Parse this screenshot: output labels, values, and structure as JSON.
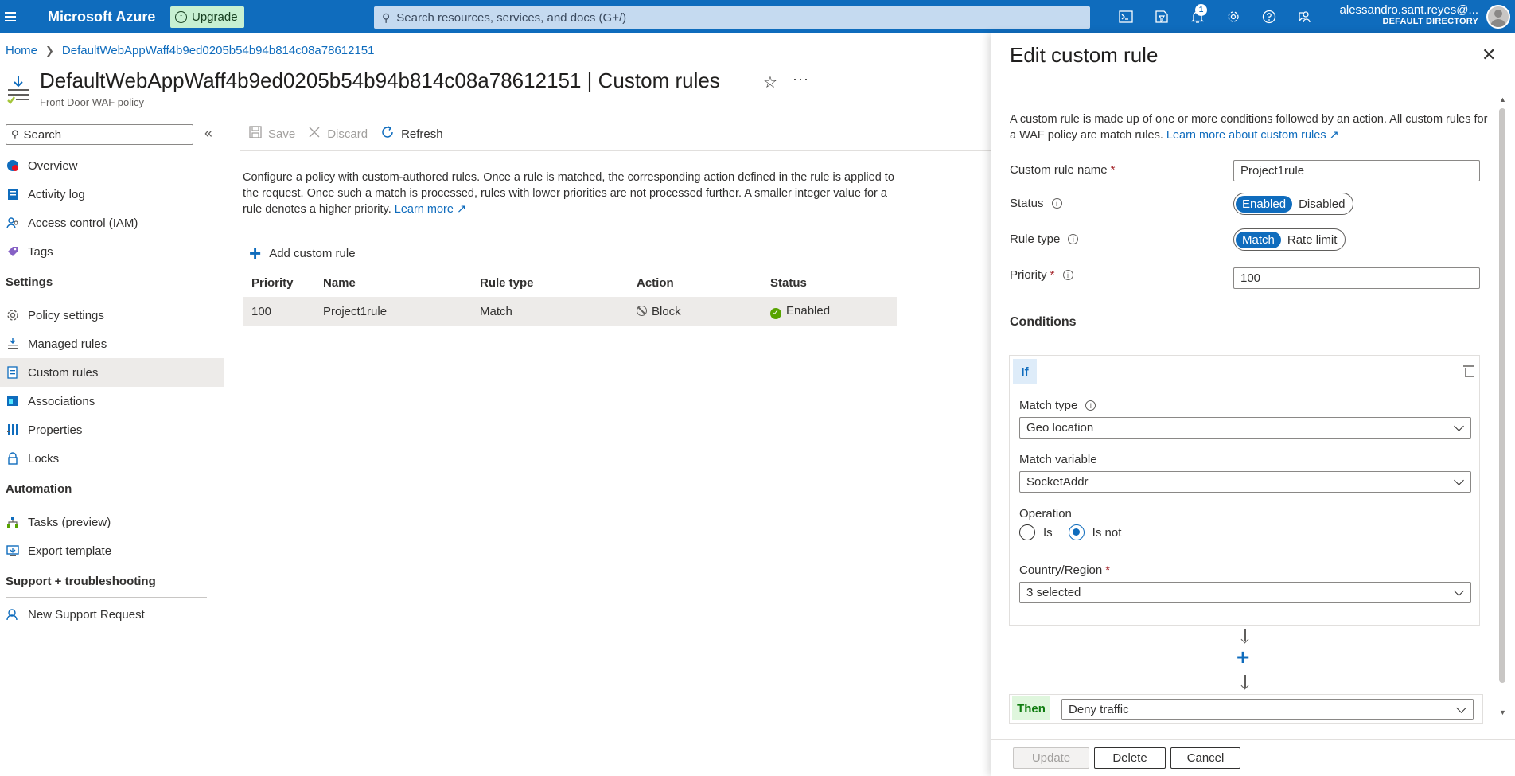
{
  "topbar": {
    "brand": "Microsoft Azure",
    "upgrade_label": "Upgrade",
    "search_placeholder": "Search resources, services, and docs (G+/)",
    "notification_count": "1",
    "user_name": "alessandro.sant.reyes@...",
    "user_directory": "DEFAULT DIRECTORY",
    "icons": [
      "cloud-shell-icon",
      "directory-filter-icon",
      "bell-icon",
      "gear-icon",
      "help-icon",
      "feedback-icon"
    ],
    "accent": "#0f6cbd"
  },
  "breadcrumb": {
    "home": "Home",
    "current": "DefaultWebAppWaff4b9ed0205b54b94b814c08a78612151"
  },
  "page": {
    "title": "DefaultWebAppWaff4b9ed0205b54b94b814c08a78612151 | Custom rules",
    "subtitle": "Front Door WAF policy"
  },
  "sidebar": {
    "search_placeholder": "Search",
    "items_top": [
      {
        "label": "Overview",
        "icon": "overview-icon"
      },
      {
        "label": "Activity log",
        "icon": "activity-log-icon"
      },
      {
        "label": "Access control (IAM)",
        "icon": "iam-icon"
      },
      {
        "label": "Tags",
        "icon": "tag-icon"
      }
    ],
    "settings_heading": "Settings",
    "settings_items": [
      {
        "label": "Policy settings",
        "icon": "gear-icon"
      },
      {
        "label": "Managed rules",
        "icon": "managed-rules-icon"
      },
      {
        "label": "Custom rules",
        "icon": "custom-rules-icon",
        "active": true
      },
      {
        "label": "Associations",
        "icon": "associations-icon"
      },
      {
        "label": "Properties",
        "icon": "properties-icon"
      },
      {
        "label": "Locks",
        "icon": "lock-icon"
      }
    ],
    "automation_heading": "Automation",
    "automation_items": [
      {
        "label": "Tasks (preview)",
        "icon": "tasks-icon"
      },
      {
        "label": "Export template",
        "icon": "export-icon"
      }
    ],
    "support_heading": "Support + troubleshooting",
    "support_items": [
      {
        "label": "New Support Request",
        "icon": "support-icon"
      }
    ]
  },
  "toolbar": {
    "save": "Save",
    "discard": "Discard",
    "refresh": "Refresh"
  },
  "main": {
    "description": "Configure a policy with custom-authored rules. Once a rule is matched, the corresponding action defined in the rule is applied to the request. Once such a match is processed, rules with lower priorities are not processed further. A smaller integer value for a rule denotes a higher priority.",
    "learn_more": "Learn more",
    "add_rule": "Add custom rule",
    "table": {
      "headers": [
        "Priority",
        "Name",
        "Rule type",
        "Action",
        "Status"
      ],
      "rows": [
        {
          "priority": "100",
          "name": "Project1rule",
          "rule_type": "Match",
          "action": "Block",
          "status": "Enabled"
        }
      ]
    }
  },
  "panel": {
    "title": "Edit custom rule",
    "description": "A custom rule is made up of one or more conditions followed by an action. All custom rules for a WAF policy are match rules.",
    "learn_more": "Learn more about custom rules",
    "name_label": "Custom rule name",
    "name_value": "Project1rule",
    "status_label": "Status",
    "status_options": [
      "Enabled",
      "Disabled"
    ],
    "status_selected": "Enabled",
    "rule_type_label": "Rule type",
    "rule_type_options": [
      "Match",
      "Rate limit"
    ],
    "rule_type_selected": "Match",
    "priority_label": "Priority",
    "priority_value": "100",
    "conditions_heading": "Conditions",
    "if_label": "If",
    "match_type_label": "Match type",
    "match_type_value": "Geo location",
    "match_variable_label": "Match variable",
    "match_variable_value": "SocketAddr",
    "operation_label": "Operation",
    "operation_options": [
      "Is",
      "Is not"
    ],
    "operation_selected": "Is not",
    "country_label": "Country/Region",
    "country_value": "3 selected",
    "then_label": "Then",
    "then_value": "Deny traffic",
    "buttons": {
      "update": "Update",
      "delete": "Delete",
      "cancel": "Cancel"
    }
  }
}
